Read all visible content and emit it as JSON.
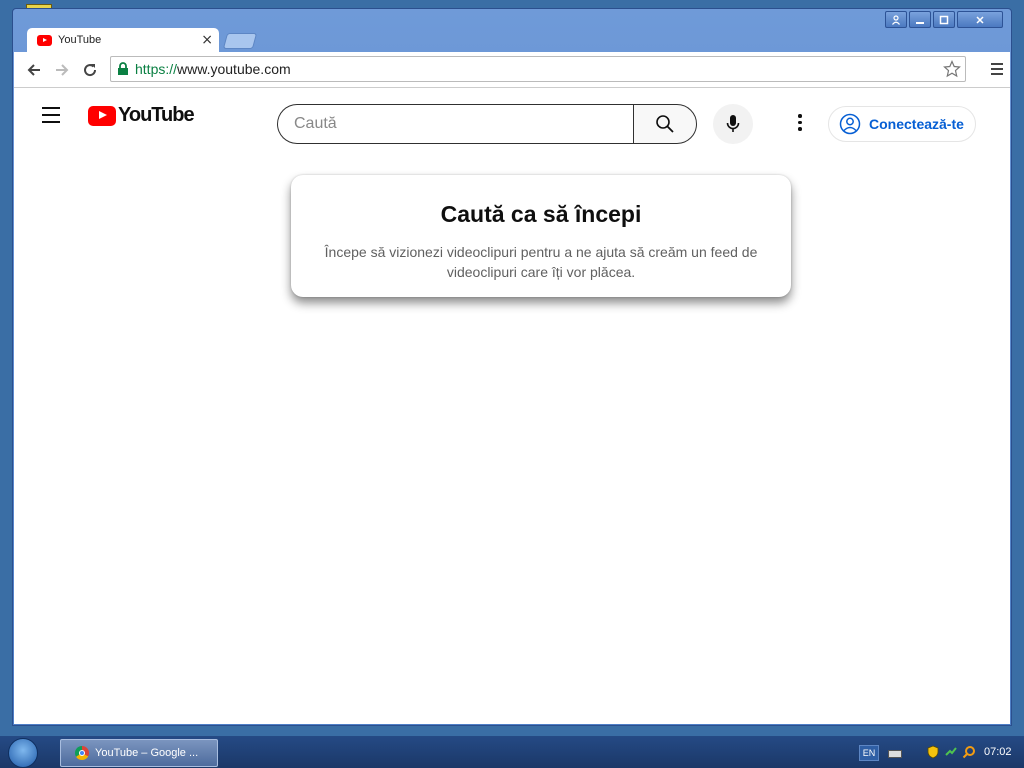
{
  "browser": {
    "tab_title": "YouTube",
    "tab_close": "×",
    "url_scheme": "https://",
    "url_rest": "www.youtube.com"
  },
  "youtube": {
    "logo_text": "YouTube",
    "search_placeholder": "Caută",
    "signin_label": "Conectează-te",
    "brand_red": "#ff0000",
    "link_blue": "#065fd4"
  },
  "prompt_card": {
    "title": "Caută ca să începi",
    "body": "Începe să vizionezi videoclipuri pentru a ne ajuta să creăm un feed de videoclipuri care îți vor plăcea."
  },
  "taskbar": {
    "task_label": "YouTube – Google ...",
    "language": "EN",
    "clock": "07:02"
  }
}
